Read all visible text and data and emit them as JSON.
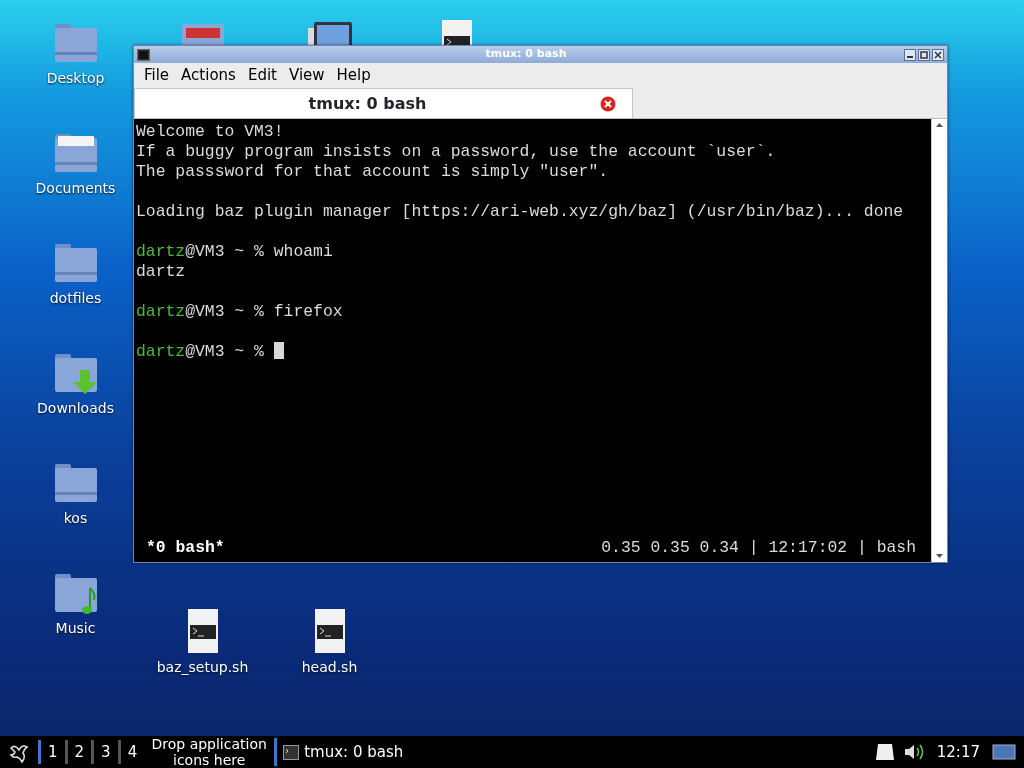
{
  "desktop_columns": [
    {
      "icons": [
        {
          "kind": "folder",
          "label": "Desktop"
        },
        {
          "kind": "documents",
          "label": "Documents"
        },
        {
          "kind": "folder",
          "label": "dotfiles"
        },
        {
          "kind": "downloads",
          "label": "Downloads"
        },
        {
          "kind": "folder",
          "label": "kos"
        },
        {
          "kind": "music",
          "label": "Music"
        }
      ]
    },
    {
      "icons": [
        {
          "kind": "photos"
        },
        {
          "kind": "script",
          "label": "baz_setup.sh"
        }
      ]
    },
    {
      "icons": [
        {
          "kind": "monitor"
        },
        {
          "kind": "script",
          "label": "head.sh"
        }
      ]
    },
    {
      "icons": [
        {
          "kind": "script"
        }
      ]
    }
  ],
  "window": {
    "title": "tmux: 0 bash",
    "menu": [
      "File",
      "Actions",
      "Edit",
      "View",
      "Help"
    ],
    "tabs": [
      {
        "label": "tmux: 0 bash",
        "selected": true
      }
    ],
    "terminal": {
      "lines": [
        {
          "kind": "text",
          "text": "Welcome to VM3!"
        },
        {
          "kind": "text",
          "text": "If a buggy program insists on a password, use the account `user`."
        },
        {
          "kind": "text",
          "text": "The passsword for that account is simply \"user\"."
        },
        {
          "kind": "blank"
        },
        {
          "kind": "text",
          "text": "Loading baz plugin manager [https://ari-web.xyz/gh/baz] (/usr/bin/baz)... done"
        },
        {
          "kind": "blank"
        },
        {
          "kind": "prompt",
          "user": "dartz",
          "rest": "@VM3 ~ % whoami",
          "cursor": false
        },
        {
          "kind": "text",
          "text": "dartz"
        },
        {
          "kind": "blank"
        },
        {
          "kind": "prompt",
          "user": "dartz",
          "rest": "@VM3 ~ % firefox",
          "cursor": false
        },
        {
          "kind": "blank"
        },
        {
          "kind": "prompt",
          "user": "dartz",
          "rest": "@VM3 ~ % ",
          "cursor": true
        }
      ],
      "status_left": "*0 bash*",
      "status_right": "0.35 0.35 0.34 | 12:17:02 | bash"
    }
  },
  "taskbar": {
    "workspaces": [
      {
        "label": "1",
        "selected": true
      },
      {
        "label": "2",
        "selected": false
      },
      {
        "label": "3",
        "selected": false
      },
      {
        "label": "4",
        "selected": false
      }
    ],
    "drop_hint": "Drop application icons here",
    "tasks": [
      {
        "label": "tmux: 0 bash"
      }
    ],
    "clock": "12:17"
  }
}
